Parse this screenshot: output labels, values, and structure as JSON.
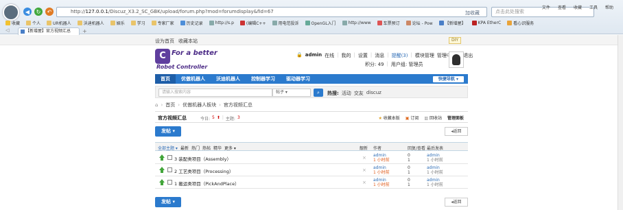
{
  "browser": {
    "url_prefix": "http://",
    "url_host": "127.0.0.1",
    "url_path": "/Discuz_X3.2_SC_GBK/upload/forum.php?mod=forumdisplay&fid=67",
    "add_fav": "加收藏",
    "search_placeholder": "点击此处搜索",
    "menu": [
      "文件",
      "查看",
      "收藏",
      "工具",
      "帮助"
    ],
    "favorites": [
      "收藏",
      "个人",
      "UR机器人",
      "沃迪机器人",
      "娱乐",
      "学习",
      "专家厂家",
      "历史记录",
      "http://s.p",
      "(编辑C++",
      "用电范投诉",
      "OpenGL入门",
      "http://www",
      "车票预订",
      "论坛 - Pow",
      "【新增屋】",
      "KPA EtherC",
      "看心识服务"
    ],
    "tab_title": "【新增屋】官方视频汇总"
  },
  "topbar": {
    "links": [
      "设为首页",
      "收藏本站"
    ],
    "diy": "DIY"
  },
  "logo": {
    "line1": "For a better",
    "line2": "Robot Controller"
  },
  "user": {
    "name": "admin",
    "online": "在线",
    "my": "我的",
    "settings": "设置",
    "messages": "消息",
    "reminders": "提醒(3)",
    "modcenter": "模块管理",
    "admincenter": "管理中心",
    "logout": "退出",
    "points": "积分: 49",
    "group": "用户组: 管理员"
  },
  "nav": {
    "items": [
      "首页",
      "优傲机器人",
      "沃迪机器人",
      "控制器学习",
      "驱动器学习"
    ],
    "quicknav": "快捷导航"
  },
  "searchbar": {
    "placeholder": "请输入搜索内容",
    "scope": "帖子",
    "hot_label": "热搜:",
    "hot": [
      "活动",
      "交友",
      "discuz"
    ]
  },
  "breadcrumb": [
    "首页",
    "优傲机器人板块",
    "官方视频汇总"
  ],
  "forum": {
    "title": "官方视频汇总",
    "today_label": "今日:",
    "today_value": "5",
    "topics_label": "主题:",
    "topics_value": "3",
    "actions": [
      "收藏本版",
      "订阅",
      "回收站",
      "管理面板"
    ]
  },
  "buttons": {
    "post": "发帖",
    "back": "返回"
  },
  "table": {
    "filters": [
      "全部主题",
      "最新",
      "热门",
      "热帖",
      "精华",
      "更多"
    ],
    "col_top": "靓新",
    "col_author": "作者",
    "col_stats": "回复/查看",
    "col_last": "最后发表",
    "rows": [
      {
        "title": "3 装配类项目（Assembly）",
        "author": "admin",
        "time": "1 小时前",
        "replies": "0",
        "views": "1",
        "last_author": "admin",
        "last_time": "1 小时前"
      },
      {
        "title": "2 工艺类项目（Processing）",
        "author": "admin",
        "time": "1 小时前",
        "replies": "0",
        "views": "1",
        "last_author": "admin",
        "last_time": "1 小时前"
      },
      {
        "title": "1 搬运类项目（PickAndPlace）",
        "author": "admin",
        "time": "1 小时前",
        "replies": "0",
        "views": "1",
        "last_author": "admin",
        "last_time": "1 小时前"
      }
    ]
  }
}
